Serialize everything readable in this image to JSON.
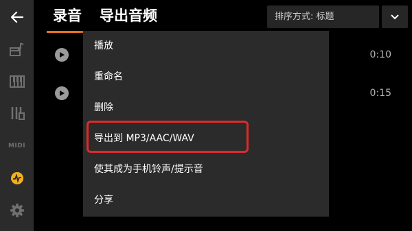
{
  "sidebar": {
    "items": [
      {
        "icon": "back-arrow-icon"
      },
      {
        "icon": "piano-note-icon"
      },
      {
        "icon": "keyboard-icon"
      },
      {
        "icon": "mixer-icon"
      },
      {
        "icon": "midi-icon",
        "label": "MIDI"
      },
      {
        "icon": "recording-icon",
        "active": true
      },
      {
        "icon": "gear-icon"
      }
    ],
    "active_color": "#f2b01e",
    "icon_color": "#707070"
  },
  "header": {
    "tab_recordings": "录音",
    "tab_export": "导出音频",
    "sort_label": "排序方式: 标题",
    "help": "?"
  },
  "recordings": [
    {
      "duration": "0:10"
    },
    {
      "duration": "0:15"
    }
  ],
  "menu": {
    "items": [
      "播放",
      "重命名",
      "删除",
      "导出到 MP3/AAC/WAV",
      "使其成为手机铃声/提示音",
      "分享"
    ]
  }
}
